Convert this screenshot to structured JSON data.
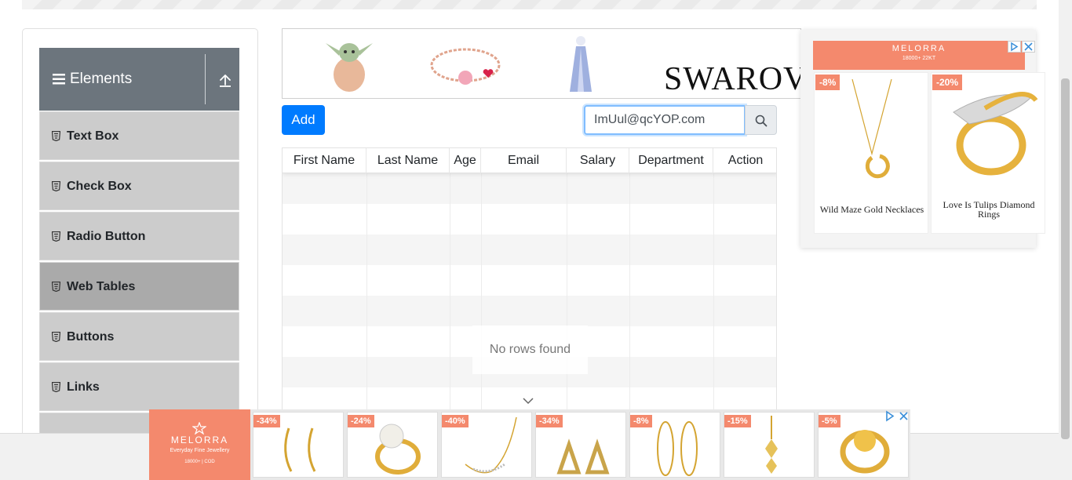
{
  "sidebar": {
    "group_title": "Elements",
    "items": [
      {
        "label": "Text Box"
      },
      {
        "label": "Check Box"
      },
      {
        "label": "Radio Button"
      },
      {
        "label": "Web Tables",
        "active": true
      },
      {
        "label": "Buttons"
      },
      {
        "label": "Links"
      }
    ]
  },
  "banner": {
    "brand_text": "SWAROVS"
  },
  "toolbar": {
    "add_label": "Add",
    "search_value": "ImUul@qcYOP.com"
  },
  "table": {
    "columns": [
      "First Name",
      "Last Name",
      "Age",
      "Email",
      "Salary",
      "Department",
      "Action"
    ],
    "rows": [],
    "empty_text": "No rows found"
  },
  "ad_right": {
    "brand": "MELORRA",
    "brand_sub": "18000+   22KT",
    "products": [
      {
        "discount": "-8%",
        "name": "Wild Maze Gold Necklaces"
      },
      {
        "discount": "-20%",
        "name": "Love Is Tulips Diamond Rings"
      }
    ]
  },
  "ad_bottom": {
    "brand": "MELORRA",
    "tagline": "Everyday Fine Jewellery",
    "stats": "18000+  |  COD",
    "discounts": [
      "-34%",
      "-24%",
      "-40%",
      "-34%",
      "-8%",
      "-15%",
      "-5%"
    ]
  },
  "colors": {
    "accent": "#007bff",
    "sidebar_header": "#6c757d",
    "menu_item": "#cccccc",
    "menu_active": "#aaaaaa",
    "ad_brand": "#f4896d"
  }
}
